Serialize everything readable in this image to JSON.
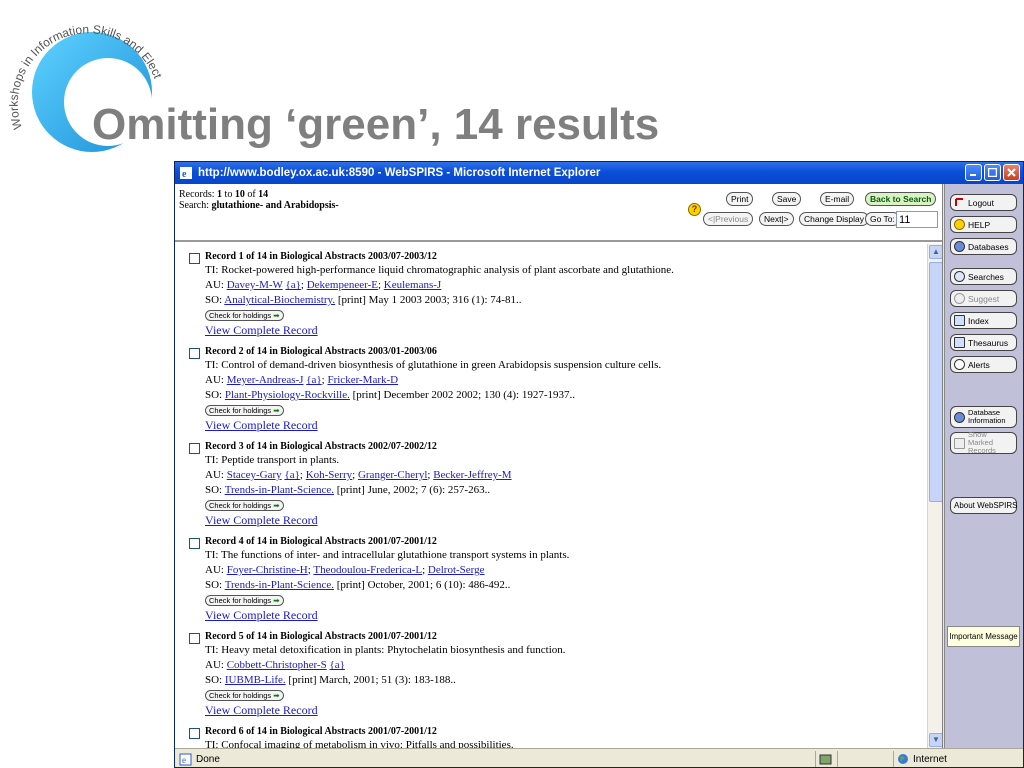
{
  "slide": {
    "title": "Omitting ‘green’, 14 results",
    "logo_text": "Workshops in Information Skills and Electronic Resources"
  },
  "window": {
    "title": "http://www.bodley.ox.ac.uk:8590 - WebSPIRS - Microsoft Internet Explorer"
  },
  "toolbar": {
    "records_label": "Records:",
    "records_from": "1",
    "records_to_word": "to",
    "records_to": "10",
    "records_of_word": "of",
    "records_total": "14",
    "search_label": "Search:",
    "search_query": "glutathione- and Arabidopsis-",
    "print": "Print",
    "save": "Save",
    "email": "E-mail",
    "back_to_search": "Back to Search",
    "previous": "<|Previous",
    "next": "Next|>",
    "change_display": "Change Display",
    "go_to": "Go To:",
    "go_to_value": "11"
  },
  "records": [
    {
      "header": "Record 1 of 14 in Biological Abstracts 2003/07-2003/12",
      "ti_label": "TI:",
      "title": "Rocket-powered high-performance liquid chromatographic analysis of plant ascorbate and glutathione.",
      "au_label": "AU:",
      "authors": [
        "Davey-M-W",
        "{a}",
        "Dekempeneer-E",
        "Keulemans-J"
      ],
      "so_label": "SO:",
      "source_link": "Analytical-Biochemistry.",
      "source_rest": " [print] May 1 2003 2003; 316 (1): 74-81..",
      "holdings": "Check for holdings",
      "view": "View Complete Record"
    },
    {
      "header": "Record 2 of 14 in Biological Abstracts 2003/01-2003/06",
      "ti_label": "TI:",
      "title": "Control of demand-driven biosynthesis of glutathione in green Arabidopsis suspension culture cells.",
      "au_label": "AU:",
      "authors": [
        "Meyer-Andreas-J",
        "{a}",
        "Fricker-Mark-D"
      ],
      "so_label": "SO:",
      "source_link": "Plant-Physiology-Rockville.",
      "source_rest": " [print] December 2002 2002; 130 (4): 1927-1937..",
      "holdings": "Check for holdings",
      "view": "View Complete Record"
    },
    {
      "header": "Record 3 of 14 in Biological Abstracts 2002/07-2002/12",
      "ti_label": "TI:",
      "title": "Peptide transport in plants.",
      "au_label": "AU:",
      "authors": [
        "Stacey-Gary",
        "{a}",
        "Koh-Serry",
        "Granger-Cheryl",
        "Becker-Jeffrey-M"
      ],
      "so_label": "SO:",
      "source_link": "Trends-in-Plant-Science.",
      "source_rest": " [print] June, 2002; 7 (6): 257-263..",
      "holdings": "Check for holdings",
      "view": "View Complete Record"
    },
    {
      "header": "Record 4 of 14 in Biological Abstracts 2001/07-2001/12",
      "ti_label": "TI:",
      "title": "The functions of inter- and intracellular glutathione transport systems in plants.",
      "au_label": "AU:",
      "authors": [
        "Foyer-Christine-H",
        "Theodoulou-Frederica-L",
        "Delrot-Serge"
      ],
      "so_label": "SO:",
      "source_link": "Trends-in-Plant-Science.",
      "source_rest": " [print] October, 2001; 6 (10): 486-492..",
      "holdings": "Check for holdings",
      "view": "View Complete Record"
    },
    {
      "header": "Record 5 of 14 in Biological Abstracts 2001/07-2001/12",
      "ti_label": "TI:",
      "title": "Heavy metal detoxification in plants: Phytochelatin biosynthesis and function.",
      "au_label": "AU:",
      "authors": [
        "Cobbett-Christopher-S",
        "{a}"
      ],
      "so_label": "SO:",
      "source_link": "IUBMB-Life.",
      "source_rest": " [print] March, 2001; 51 (3): 183-188..",
      "holdings": "Check for holdings",
      "view": "View Complete Record"
    },
    {
      "header": "Record 6 of 14 in Biological Abstracts 2001/07-2001/12",
      "ti_label": "TI:",
      "title": "Confocal imaging of metabolism in vivo: Pitfalls and possibilities.",
      "au_label": "",
      "authors": [],
      "so_label": "",
      "source_link": "",
      "source_rest": "",
      "holdings": "",
      "view": ""
    }
  ],
  "nav": {
    "logout": "Logout",
    "help": "HELP",
    "databases": "Databases",
    "searches": "Searches",
    "suggest": "Suggest",
    "index": "Index",
    "thesaurus": "Thesaurus",
    "alerts": "Alerts",
    "database_information": "Database Information",
    "show_marked_records": "Show Marked Records",
    "important_message": "Important Message",
    "about": "About WebSPIRS"
  },
  "status": {
    "done": "Done",
    "zone": "Internet"
  },
  "colors": {
    "title_gray": "#7f7f7f",
    "link_blue": "#1a1acc",
    "titlebar_blue": "#0a4fd8",
    "nav_bg": "#c0c0d8"
  }
}
